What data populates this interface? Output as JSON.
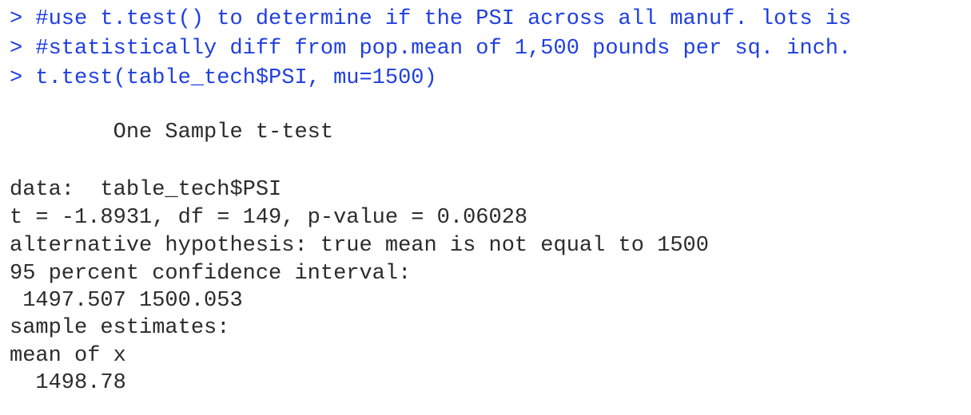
{
  "console": {
    "commands": [
      "> #use t.test() to determine if the PSI across all manuf. lots is",
      "> #statistically diff from pop.mean of 1,500 pounds per sq. inch.",
      "> t.test(table_tech$PSI, mu=1500)"
    ],
    "output": {
      "test_title": "        One Sample t-test",
      "data_line": "data:  table_tech$PSI",
      "stats_line": "t = -1.8931, df = 149, p-value = 0.06028",
      "alternative_line": "alternative hypothesis: true mean is not equal to 1500",
      "ci_label": "95 percent confidence interval:",
      "ci_values": " 1497.507 1500.053",
      "estimates_label": "sample estimates:",
      "mean_label": "mean of x",
      "mean_value": "  1498.78"
    }
  },
  "colors": {
    "command_text": "#1f3fe0",
    "output_text": "#2b2b2b",
    "background": "#ffffff"
  }
}
